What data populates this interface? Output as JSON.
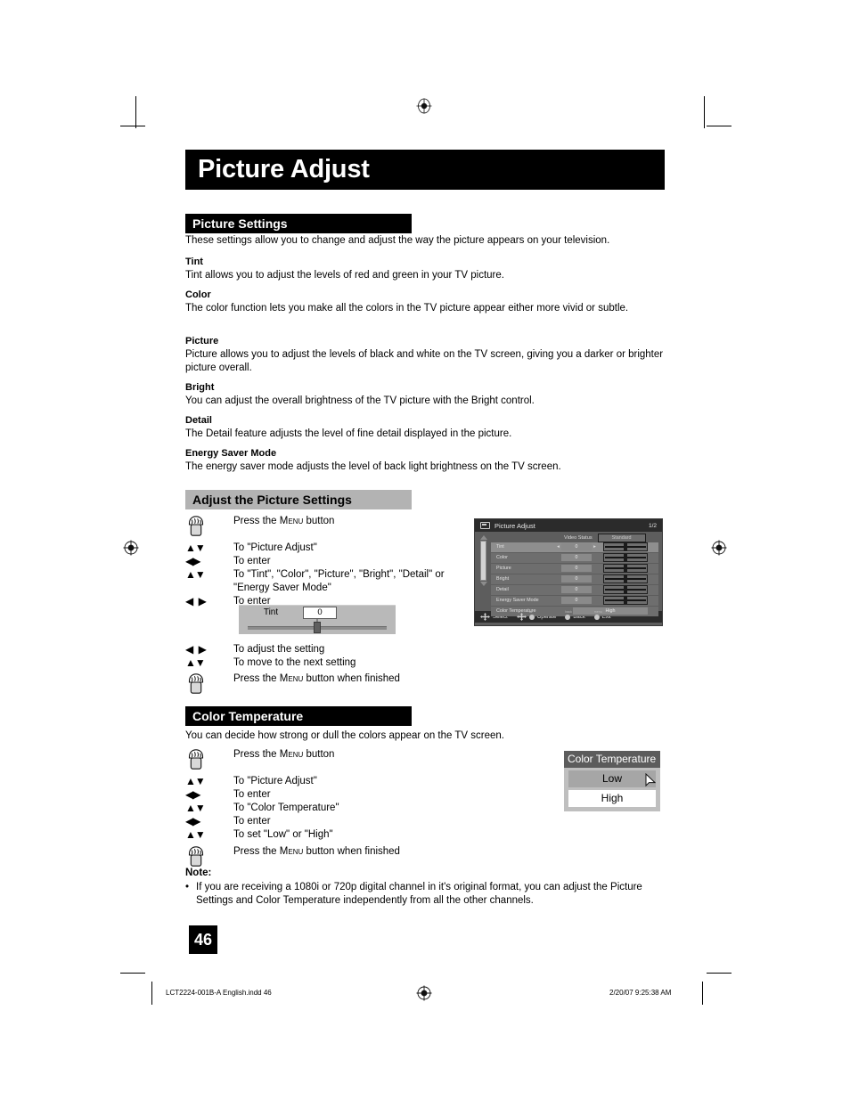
{
  "doc": {
    "title": "Picture Adjust",
    "page_number": "46"
  },
  "picture_settings": {
    "heading": "Picture Settings",
    "intro": "These settings allow you to change and adjust the way the picture appears on your television.",
    "items": [
      {
        "term": "Tint",
        "desc": "Tint allows you to adjust the levels of red and green in your TV picture."
      },
      {
        "term": "Color",
        "desc": "The color function lets you make all the colors in the TV picture appear either more vivid or subtle."
      },
      {
        "term": "Picture",
        "desc": "Picture allows you to adjust the levels of black and white on the TV screen, giving you a darker or brighter picture overall."
      },
      {
        "term": "Bright",
        "desc": "You can adjust the overall brightness of the TV picture with the Bright control."
      },
      {
        "term": "Detail",
        "desc": "The Detail feature adjusts the level of fine detail displayed in the picture."
      },
      {
        "term": "Energy Saver Mode",
        "desc": "The energy saver mode adjusts the level of back light brightness on the TV screen."
      }
    ]
  },
  "adjust_section": {
    "heading": "Adjust the Picture Settings",
    "steps_top": [
      {
        "icon": "hand-press-icon",
        "arrows": "",
        "text_pre": "Press the ",
        "text_sc": "Menu",
        "text_post": " button"
      },
      {
        "icon": "up-down-arrows-icon",
        "arrows": "▲▼",
        "text_pre": "To \"Picture Adjust\"",
        "text_sc": "",
        "text_post": ""
      },
      {
        "icon": "left-right-arrows-icon",
        "arrows": "◀▶",
        "text_pre": "To enter",
        "text_sc": "",
        "text_post": ""
      },
      {
        "icon": "up-down-arrows-icon",
        "arrows": "▲▼",
        "text_pre": "To \"Tint\", \"Color\", \"Picture\", \"Bright\", \"Detail\" or \"Energy Saver Mode\"",
        "text_sc": "",
        "text_post": ""
      },
      {
        "icon": "left-right-arrows-icon",
        "arrows": "◀ ▶",
        "text_pre": "To enter",
        "text_sc": "",
        "text_post": ""
      }
    ],
    "steps_bottom": [
      {
        "icon": "left-right-arrows-icon",
        "arrows": "◀ ▶",
        "text_pre": "To adjust the setting",
        "text_sc": "",
        "text_post": ""
      },
      {
        "icon": "up-down-arrows-icon",
        "arrows": "▲▼",
        "text_pre": "To move to the next setting",
        "text_sc": "",
        "text_post": ""
      },
      {
        "icon": "hand-press-icon",
        "arrows": "",
        "text_pre": "Press the ",
        "text_sc": "Menu",
        "text_post": " button when finished"
      }
    ],
    "tint_widget": {
      "label": "Tint",
      "value": "0"
    }
  },
  "osd": {
    "title": "Picture Adjust",
    "page_indicator": "1/2",
    "video_status_label": "Video Status",
    "video_status_value": "Standard",
    "rows": [
      {
        "name": "Tint",
        "value": "0",
        "selected": true,
        "type": "slider"
      },
      {
        "name": "Color",
        "value": "0",
        "selected": false,
        "type": "slider"
      },
      {
        "name": "Picture",
        "value": "0",
        "selected": false,
        "type": "slider"
      },
      {
        "name": "Bright",
        "value": "0",
        "selected": false,
        "type": "slider"
      },
      {
        "name": "Detail",
        "value": "0",
        "selected": false,
        "type": "slider"
      },
      {
        "name": "Energy Saver Mode",
        "value": "0",
        "selected": false,
        "type": "slider"
      },
      {
        "name": "Color Temperature",
        "value": "High",
        "selected": false,
        "type": "choice"
      }
    ],
    "footer": [
      {
        "label": "Select",
        "mini": "",
        "glyph": "dpad"
      },
      {
        "label": "Operate",
        "mini": "ok",
        "glyph": "dpad-dot"
      },
      {
        "label": "Back",
        "mini": "back",
        "glyph": "dot"
      },
      {
        "label": "Exit",
        "mini": "menu",
        "glyph": "dot"
      }
    ]
  },
  "color_temperature": {
    "heading": "Color Temperature",
    "intro": "You can decide how strong or dull the colors appear on the TV screen.",
    "steps": [
      {
        "icon": "hand-press-icon",
        "arrows": "",
        "text_pre": "Press the ",
        "text_sc": "Menu",
        "text_post": " button"
      },
      {
        "icon": "up-down-arrows-icon",
        "arrows": "▲▼",
        "text_pre": "To \"Picture Adjust\"",
        "text_sc": "",
        "text_post": ""
      },
      {
        "icon": "left-right-arrows-icon",
        "arrows": "◀▶",
        "text_pre": "To enter",
        "text_sc": "",
        "text_post": ""
      },
      {
        "icon": "up-down-arrows-icon",
        "arrows": "▲▼",
        "text_pre": "To \"Color Temperature\"",
        "text_sc": "",
        "text_post": ""
      },
      {
        "icon": "left-right-arrows-icon",
        "arrows": "◀▶",
        "text_pre": "To enter",
        "text_sc": "",
        "text_post": ""
      },
      {
        "icon": "up-down-arrows-icon",
        "arrows": "▲▼",
        "text_pre": "To set \"Low\" or \"High\"",
        "text_sc": "",
        "text_post": ""
      },
      {
        "icon": "hand-press-icon",
        "arrows": "",
        "text_pre": "Press the ",
        "text_sc": "Menu",
        "text_post": " button when finished"
      }
    ],
    "popup": {
      "title": "Color Temperature",
      "options": [
        {
          "label": "Low",
          "selected": true
        },
        {
          "label": "High",
          "selected": false
        }
      ]
    }
  },
  "note": {
    "heading": "Note:",
    "bullet": "•",
    "text": "If you are receiving a 1080i or 720p digital channel in it's original format, you can adjust the Picture Settings and Color Temperature independently from all the other channels."
  },
  "footer": {
    "file": "LCT2224-001B-A English.indd   46",
    "timestamp": "2/20/07   9:25:38 AM"
  },
  "colors": {
    "black": "#000000",
    "gray_heading": "#b3b3b3",
    "osd_bg": "#5d5d5d",
    "osd_header": "#2b2b2b",
    "popup_bg": "#bfbfbf"
  }
}
